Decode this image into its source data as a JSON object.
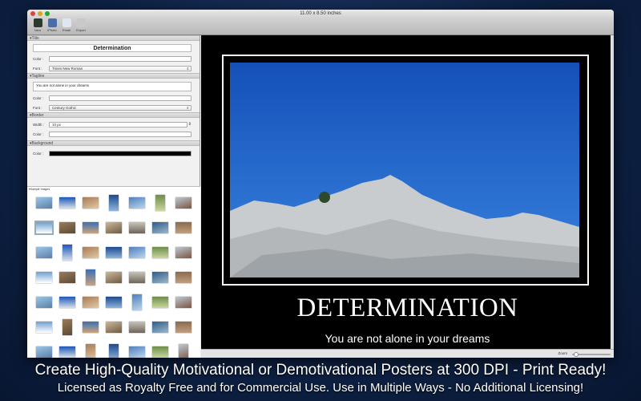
{
  "window": {
    "title": "11.00 x 8.50 inches"
  },
  "toolbar": [
    {
      "label": "New",
      "icon": "new-poster-icon",
      "color": "#2b3a2a"
    },
    {
      "label": "iPhoto",
      "icon": "iphoto-icon",
      "color": "#4a6ea8"
    },
    {
      "label": "Email",
      "icon": "email-icon",
      "color": "#dfe6ef"
    },
    {
      "label": "Export",
      "icon": "export-icon",
      "color": "#c9c9c9"
    }
  ],
  "title_section": {
    "header": "▾Title",
    "value": "Determination",
    "color_label": "Color :",
    "font_label": "Font :",
    "font": "Times New Roman"
  },
  "tagline_section": {
    "header": "▾Tagline",
    "value": "You are not alone in your dreams",
    "color_label": "Color :",
    "font_label": "Font :",
    "font": "Century Gothic"
  },
  "border_section": {
    "header": "▾Border",
    "width_label": "Width :",
    "width": "10 px",
    "color_label": "Color :"
  },
  "background_section": {
    "header": "▾Background",
    "color_label": "Color :",
    "color": "#000000"
  },
  "samples": {
    "header": "▾Sample Images"
  },
  "poster": {
    "title": "DETERMINATION",
    "tagline": "You are not alone in your dreams"
  },
  "status": {
    "zoom_label": "Zoom",
    "zoom_value": 0.05
  },
  "captions": {
    "line1": "Create High-Quality Motivational or Demotivational Posters at 300 DPI - Print Ready!",
    "line2": "Licensed as Royalty Free and for Commercial Use.  Use in Multiple Ways - No Additional Licensing!"
  }
}
